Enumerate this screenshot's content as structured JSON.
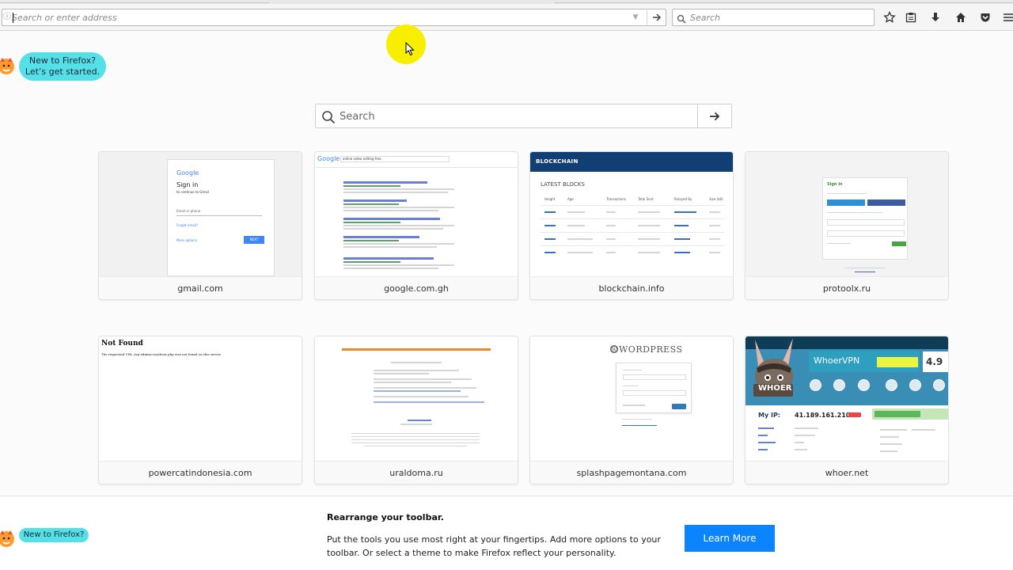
{
  "toolbar": {
    "address_placeholder": "Search or enter address",
    "search_placeholder": "Search"
  },
  "onboarding": {
    "bubble_line1": "New to Firefox?",
    "bubble_line2": "Let’s get started.",
    "bubble_short": "New to Firefox?"
  },
  "page_search": {
    "placeholder": "Search"
  },
  "top_sites": [
    {
      "label": "gmail.com"
    },
    {
      "label": "google.com.gh"
    },
    {
      "label": "blockchain.info"
    },
    {
      "label": "protoolx.ru"
    },
    {
      "label": "powercatindonesia.com"
    },
    {
      "label": "uraldoma.ru"
    },
    {
      "label": "splashpagemontana.com"
    },
    {
      "label": "whoer.net"
    }
  ],
  "thumbs": {
    "gmail": {
      "logo": "Google",
      "heading": "Sign in",
      "sub": "to continue to Gmail",
      "field": "Email or phone",
      "forgot": "Forgot email?",
      "more": "More options",
      "next": "NEXT"
    },
    "google": {
      "logo": "Google",
      "query": "online video editing free"
    },
    "blockchain": {
      "brand": "BLOCKCHAIN",
      "section": "LATEST BLOCKS",
      "cols": [
        "Height",
        "Age",
        "Transactions",
        "Total Sent",
        "Relayed By",
        "Size (kB)"
      ]
    },
    "protoolx": {
      "heading": "Sign In"
    },
    "notfound": {
      "title": "Not Found",
      "body": "The requested URL /wp-admin/css/about.php was not found on this server."
    },
    "wordpress": {
      "logo": "WORDPRESS"
    },
    "whoer": {
      "brand": "WHOER",
      "banner": "WhoerVPN",
      "price": "4.9",
      "ip_label": "My IP:",
      "ip": "41.189.161.210"
    }
  },
  "notification": {
    "title": "Rearrange your toolbar.",
    "body": "Put the tools you use most right at your fingertips. Add more options to your toolbar. Or select a theme to make Firefox reflect your personality.",
    "button": "Learn More"
  },
  "colors": {
    "accent_blue": "#0a84ff",
    "bubble": "#55dfe6",
    "cursor_highlight": "#f8ee00"
  }
}
